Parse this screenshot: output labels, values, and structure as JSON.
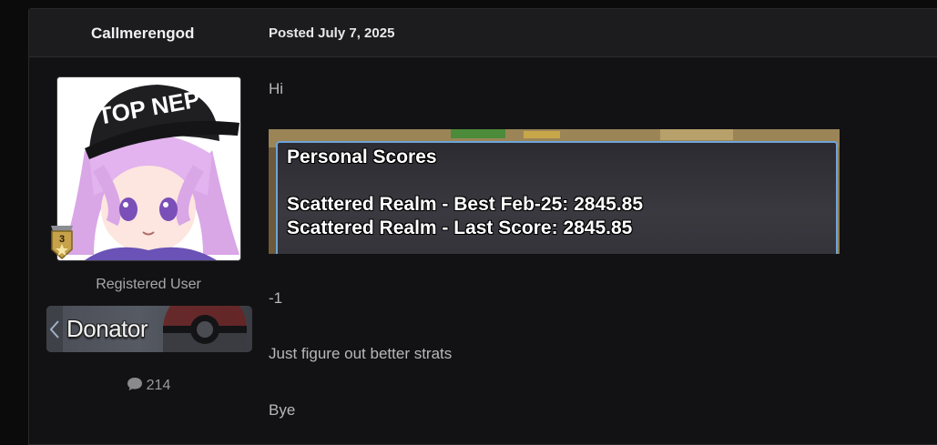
{
  "post": {
    "author": "Callmerengod",
    "date": "Posted July 7, 2025",
    "author_panel": {
      "avatar_text": "TOP NEP",
      "rank_badge_number": "3",
      "user_title": "Registered User",
      "donator_label": "Donator",
      "post_count": "214",
      "post_count_icon": "speech-bubble-icon"
    },
    "body": {
      "greeting": "Hi",
      "score_image": {
        "heading": "Personal Scores",
        "best_line": "Scattered Realm - Best Feb-25: 2845.85",
        "last_line": "Scattered Realm - Last Score: 2845.85"
      },
      "line_1": "-1",
      "line_2": "Just figure out better strats",
      "line_3": "Bye"
    }
  },
  "colors": {
    "page_bg": "#0b0b0c",
    "post_bg": "#121214",
    "header_bg": "#1c1c1f",
    "text_primary": "#f1f1f1",
    "text_body": "#b8b8b8",
    "score_border": "#6ea3d8"
  }
}
